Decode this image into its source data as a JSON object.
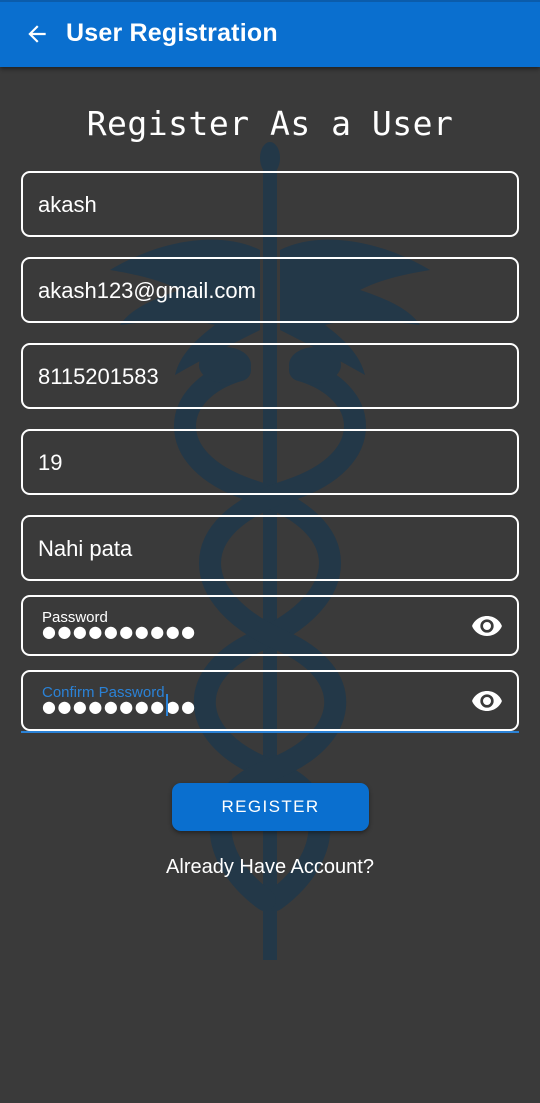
{
  "app_bar": {
    "title": "User Registration",
    "back_icon": "arrow-left-icon",
    "color": "#0a6fcf"
  },
  "form": {
    "heading": "Register As a User",
    "fields": [
      {
        "name": "name",
        "value": "akash"
      },
      {
        "name": "email",
        "value": "akash123@gmail.com"
      },
      {
        "name": "phone",
        "value": "8115201583"
      },
      {
        "name": "age",
        "value": "19"
      },
      {
        "name": "address",
        "value": "Nahi pata"
      }
    ],
    "password": {
      "label": "Password",
      "masked_value": "●●●●●●●●●●",
      "toggle_icon": "eye-icon"
    },
    "confirm_password": {
      "label": "Confirm Password",
      "masked_value": "●●●●●●●●●●",
      "toggle_icon": "eye-icon",
      "focused": true
    }
  },
  "actions": {
    "register_label": "REGISTER",
    "login_link": "Already Have Account?"
  },
  "background": {
    "watermark_icon": "caduceus-icon",
    "color": "#3a3a3a",
    "accent": "#2b82d6"
  }
}
